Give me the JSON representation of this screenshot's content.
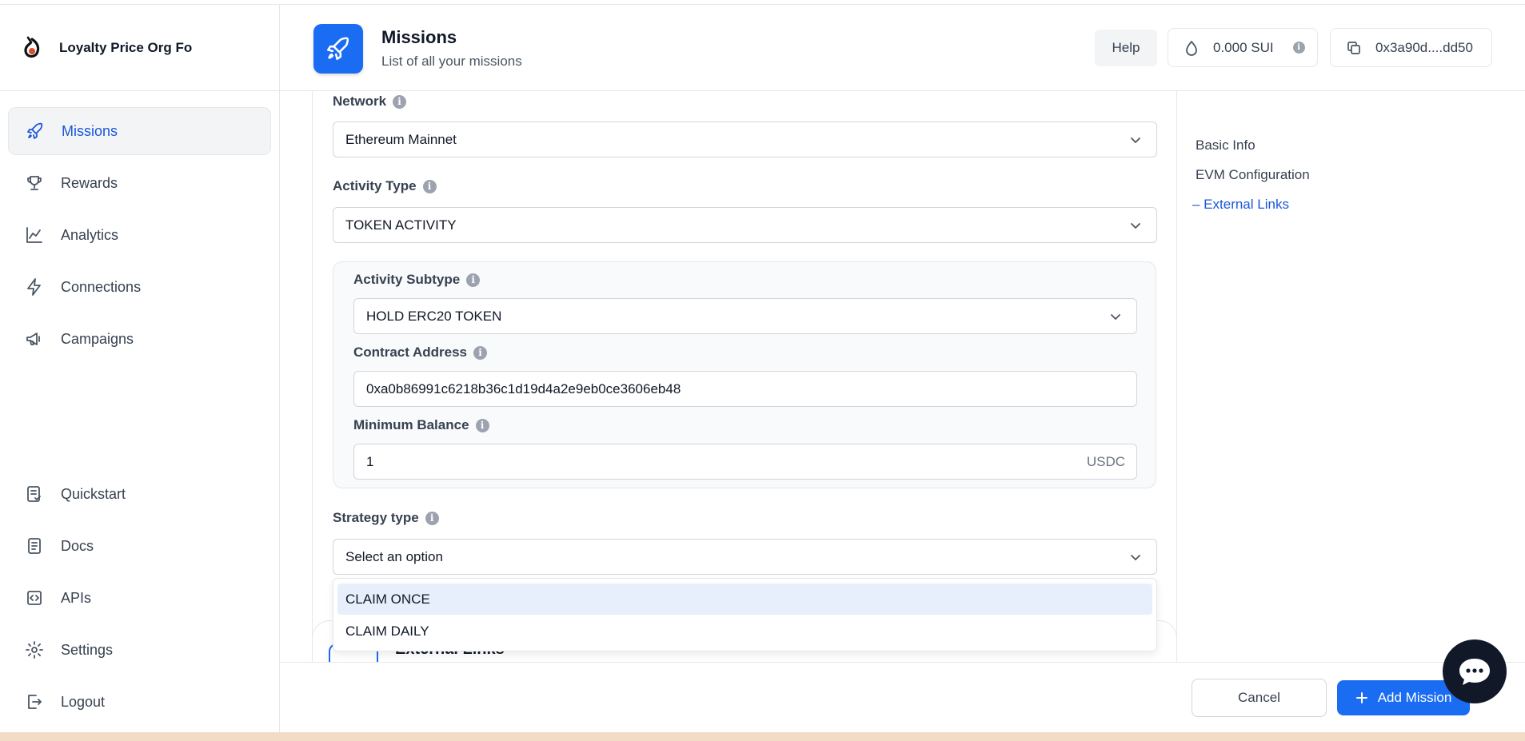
{
  "brand": {
    "name": "Loyalty Price Org Fo"
  },
  "sidebar": {
    "items": [
      {
        "label": "Missions",
        "icon": "rocket-icon",
        "active": true
      },
      {
        "label": "Rewards",
        "icon": "trophy-icon"
      },
      {
        "label": "Analytics",
        "icon": "chart-line-icon"
      },
      {
        "label": "Connections",
        "icon": "bolt-icon"
      },
      {
        "label": "Campaigns",
        "icon": "megaphone-icon"
      }
    ],
    "bottom_items": [
      {
        "label": "Quickstart",
        "icon": "checklist-icon"
      },
      {
        "label": "Docs",
        "icon": "document-icon"
      },
      {
        "label": "APIs",
        "icon": "code-icon"
      },
      {
        "label": "Settings",
        "icon": "gear-icon"
      },
      {
        "label": "Logout",
        "icon": "logout-icon"
      }
    ]
  },
  "header": {
    "title": "Missions",
    "subtitle": "List of all your missions",
    "help_label": "Help",
    "balance": "0.000 SUI",
    "wallet_address": "0x3a90d....dd50"
  },
  "form": {
    "network": {
      "label": "Network",
      "value": "Ethereum Mainnet"
    },
    "activity_type": {
      "label": "Activity Type",
      "value": "TOKEN ACTIVITY"
    },
    "activity_subtype": {
      "label": "Activity Subtype",
      "value": "HOLD ERC20 TOKEN"
    },
    "contract_address": {
      "label": "Contract Address",
      "value": "0xa0b86991c6218b36c1d19d4a2e9eb0ce3606eb48"
    },
    "minimum_balance": {
      "label": "Minimum Balance",
      "value": "1",
      "suffix": "USDC"
    },
    "strategy_type": {
      "label": "Strategy type",
      "placeholder": "Select an option",
      "options": [
        "CLAIM ONCE",
        "CLAIM DAILY"
      ],
      "highlighted": "CLAIM ONCE"
    }
  },
  "external_links_card": {
    "title": "External Links"
  },
  "outline": {
    "items": [
      "Basic Info",
      "EVM Configuration",
      "– External Links"
    ],
    "active": "– External Links"
  },
  "footer": {
    "cancel_label": "Cancel",
    "add_label": "Add Mission",
    "add_icon": "plus-icon"
  },
  "colors": {
    "accent": "#1a6cf2",
    "active_text": "#1a56db",
    "chat_button": "#111827"
  }
}
